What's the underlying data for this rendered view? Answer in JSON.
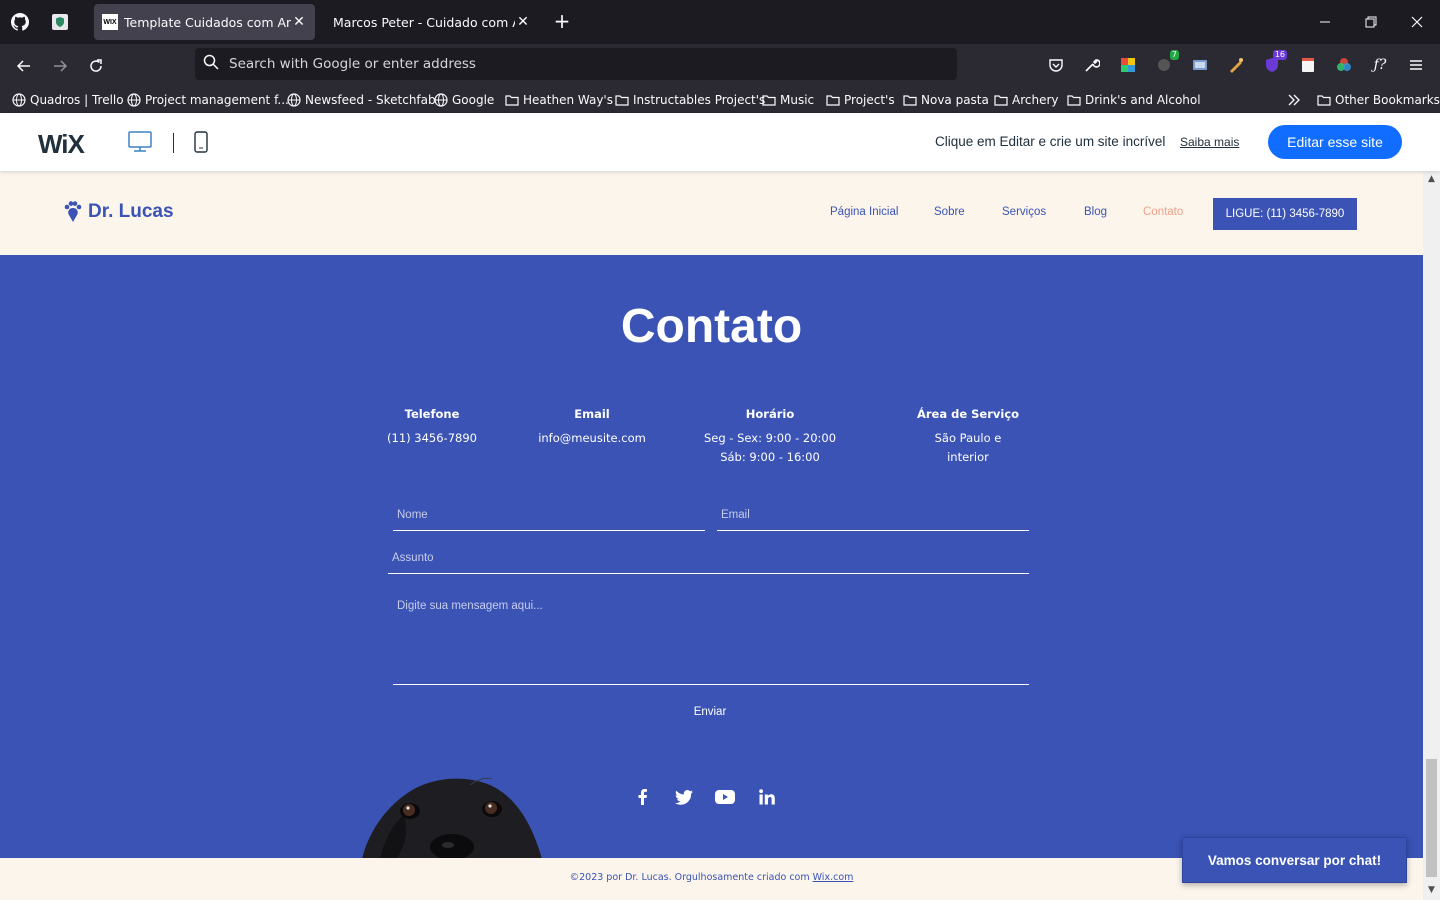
{
  "browser": {
    "tabs": [
      {
        "title": "Template Cuidados com Anima",
        "active": true,
        "favicon": "wix"
      },
      {
        "title": "Marcos Peter - Cuidado com Anima",
        "active": false
      }
    ],
    "pinned_tabs": [
      "github-icon",
      "shield-icon"
    ],
    "address_placeholder": "Search with Google or enter address",
    "bookmarks": [
      {
        "label": "Quadros | Trello",
        "type": "globe"
      },
      {
        "label": "Project management f...",
        "type": "globe"
      },
      {
        "label": "Newsfeed - Sketchfab",
        "type": "globe"
      },
      {
        "label": "Google",
        "type": "globe"
      },
      {
        "label": "Heathen Way's",
        "type": "folder"
      },
      {
        "label": "Instructables Project's",
        "type": "folder"
      },
      {
        "label": "Music",
        "type": "folder"
      },
      {
        "label": "Project's",
        "type": "folder"
      },
      {
        "label": "Nova pasta",
        "type": "folder"
      },
      {
        "label": "Archery",
        "type": "folder"
      },
      {
        "label": "Drink's and Alcohol",
        "type": "folder"
      }
    ],
    "other_bookmarks": "Other Bookmarks",
    "extension_badges": {
      "first": "7",
      "second": "16"
    }
  },
  "wix": {
    "logo": "WiX",
    "promo": "Clique em Editar e crie um site incrível",
    "learn_more": "Saiba mais",
    "edit_button": "Editar esse site"
  },
  "site": {
    "brand": "Dr. Lucas",
    "nav": [
      "Página Inicial",
      "Sobre",
      "Serviços",
      "Blog",
      "Contato"
    ],
    "nav_active": "Contato",
    "call_button": "LIGUE: (11) 3456-7890",
    "contact_title": "Contato",
    "info": {
      "phone": {
        "label": "Telefone",
        "value": "(11) 3456-7890"
      },
      "email": {
        "label": "Email",
        "value": "info@meusite.com"
      },
      "hours": {
        "label": "Horário",
        "line1": "Seg - Sex: 9:00 - 20:00",
        "line2": "Sáb: 9:00 - 16:00"
      },
      "area": {
        "label": "Área de Serviço",
        "line1": "São Paulo e",
        "line2": "interior"
      }
    },
    "form": {
      "name_placeholder": "Nome",
      "email_placeholder": "Email",
      "subject_placeholder": "Assunto",
      "message_placeholder": "Digite sua mensagem aqui...",
      "send_label": "Enviar"
    },
    "social": [
      "facebook-icon",
      "twitter-icon",
      "youtube-icon",
      "linkedin-icon"
    ],
    "footer_text": "©2023 por Dr. Lucas. Orgulhosamente criado com ",
    "footer_link": "Wix.com",
    "chat_button": "Vamos conversar por chat!"
  },
  "colors": {
    "site_blue": "#3a53b5",
    "cream": "#fbf5ec",
    "accent_salmon": "#f2a087",
    "wix_blue": "#116dff"
  }
}
